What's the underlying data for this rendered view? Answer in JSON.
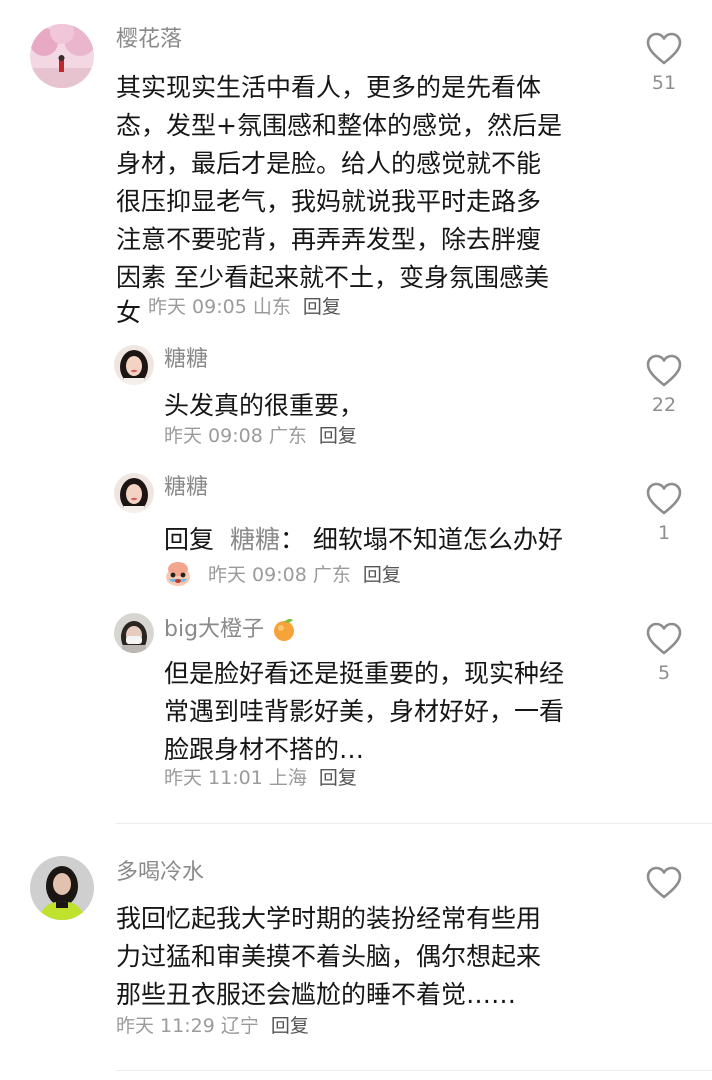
{
  "comments": [
    {
      "user": "樱花落",
      "lines": [
        "其实现实生活中看人，更多的是先看体",
        "态，发型+氛围感和整体的感觉，然后是",
        "身材，最后才是脸。给人的感觉就不能",
        "很压抑显老气，我妈就说我平时走路多",
        "注意不要驼背，再弄弄发型，除去胖瘦",
        "因素 至少看起来就不土，变身氛围感美"
      ],
      "last_line": "女",
      "time": "昨天 09:05",
      "location": "山东",
      "reply_label": "回复",
      "likes": "51",
      "replies": [
        {
          "user": "糖糖",
          "text": "头发真的很重要，",
          "time": "昨天 09:08",
          "location": "广东",
          "reply_label": "回复",
          "likes": "22"
        },
        {
          "user": "糖糖",
          "reply_prefix": "回复",
          "reply_to": "糖糖",
          "text": "：  细软塌不知道怎么办好",
          "time": "昨天 09:08",
          "location": "广东",
          "reply_label": "回复",
          "likes": "1"
        },
        {
          "user": "big大橙子",
          "lines": [
            "但是脸好看还是挺重要的，现实种经",
            "常遇到哇背影好美，身材好好，一看",
            "脸跟身材不搭的…"
          ],
          "time": "昨天 11:01",
          "location": "上海",
          "reply_label": "回复",
          "likes": "5"
        }
      ]
    },
    {
      "user": "多喝冷水",
      "lines": [
        "我回忆起我大学时期的装扮经常有些用",
        "力过猛和审美摸不着头脑，偶尔想起来",
        "那些丑衣服还会尴尬的睡不着觉……"
      ],
      "time": "昨天 11:29",
      "location": "辽宁",
      "reply_label": "回复"
    }
  ],
  "icons": {
    "like": "heart-outline-icon",
    "badge": "orange-emoji-icon",
    "sticker": "crying-sticker-icon"
  },
  "colors": {
    "text": "#161616",
    "name": "#8a8a8a",
    "meta": "#9b9b9b"
  }
}
